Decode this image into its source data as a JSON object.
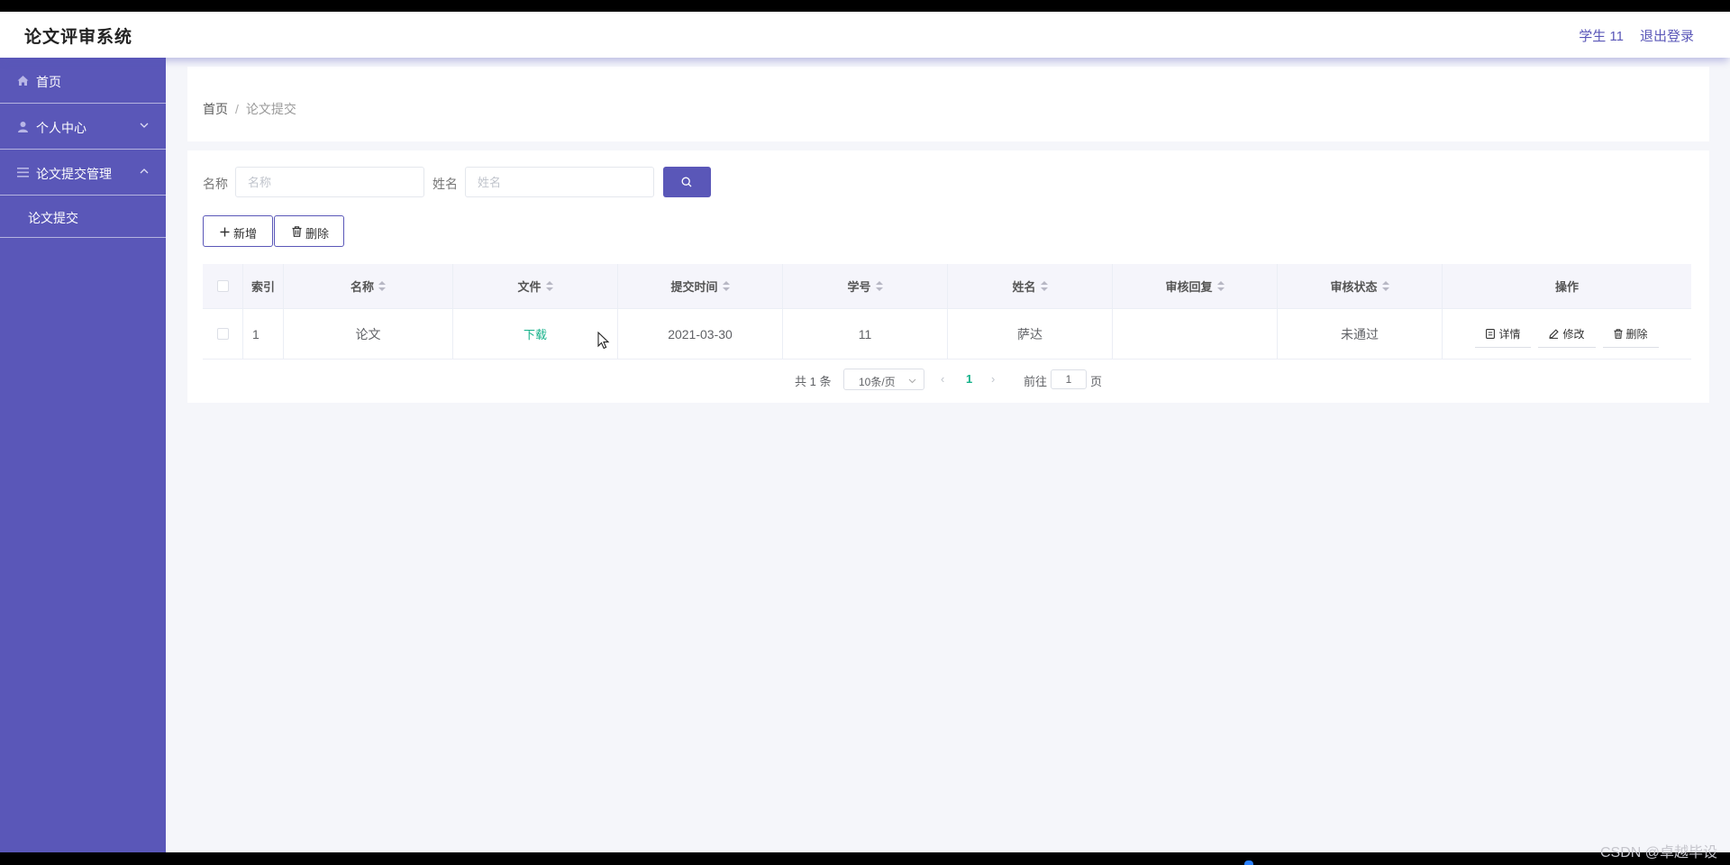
{
  "header": {
    "title": "论文评审系统",
    "user": "学生 11",
    "logout": "退出登录"
  },
  "sidebar": {
    "items": [
      {
        "label": "首页",
        "icon": "home-icon"
      },
      {
        "label": "个人中心",
        "icon": "user-icon",
        "expanded": false
      },
      {
        "label": "论文提交管理",
        "icon": "menu-icon",
        "expanded": true
      }
    ],
    "sub_items": [
      {
        "label": "论文提交"
      }
    ]
  },
  "breadcrumb": {
    "home": "首页",
    "separator": "/",
    "current": "论文提交"
  },
  "search": {
    "name_label": "名称",
    "name_placeholder": "名称",
    "person_label": "姓名",
    "person_placeholder": "姓名"
  },
  "toolbar": {
    "add_label": "新增",
    "delete_label": "删除"
  },
  "table": {
    "columns": [
      "索引",
      "名称",
      "文件",
      "提交时间",
      "学号",
      "姓名",
      "审核回复",
      "审核状态",
      "操作"
    ],
    "rows": [
      {
        "index": "1",
        "name": "论文",
        "file": "下载",
        "submit_time": "2021-03-30",
        "student_id": "11",
        "student_name": "萨达",
        "reply": "",
        "status": "未通过"
      }
    ],
    "actions": {
      "detail": "详情",
      "edit": "修改",
      "delete": "删除"
    }
  },
  "pagination": {
    "total": "共 1 条",
    "page_size": "10条/页",
    "current_page": "1",
    "goto_label": "前往",
    "goto_value": "1",
    "page_unit": "页"
  },
  "watermark": "CSDN @卓越毕设",
  "colors": {
    "brand": "#5a57b8",
    "link": "#17b28a"
  }
}
